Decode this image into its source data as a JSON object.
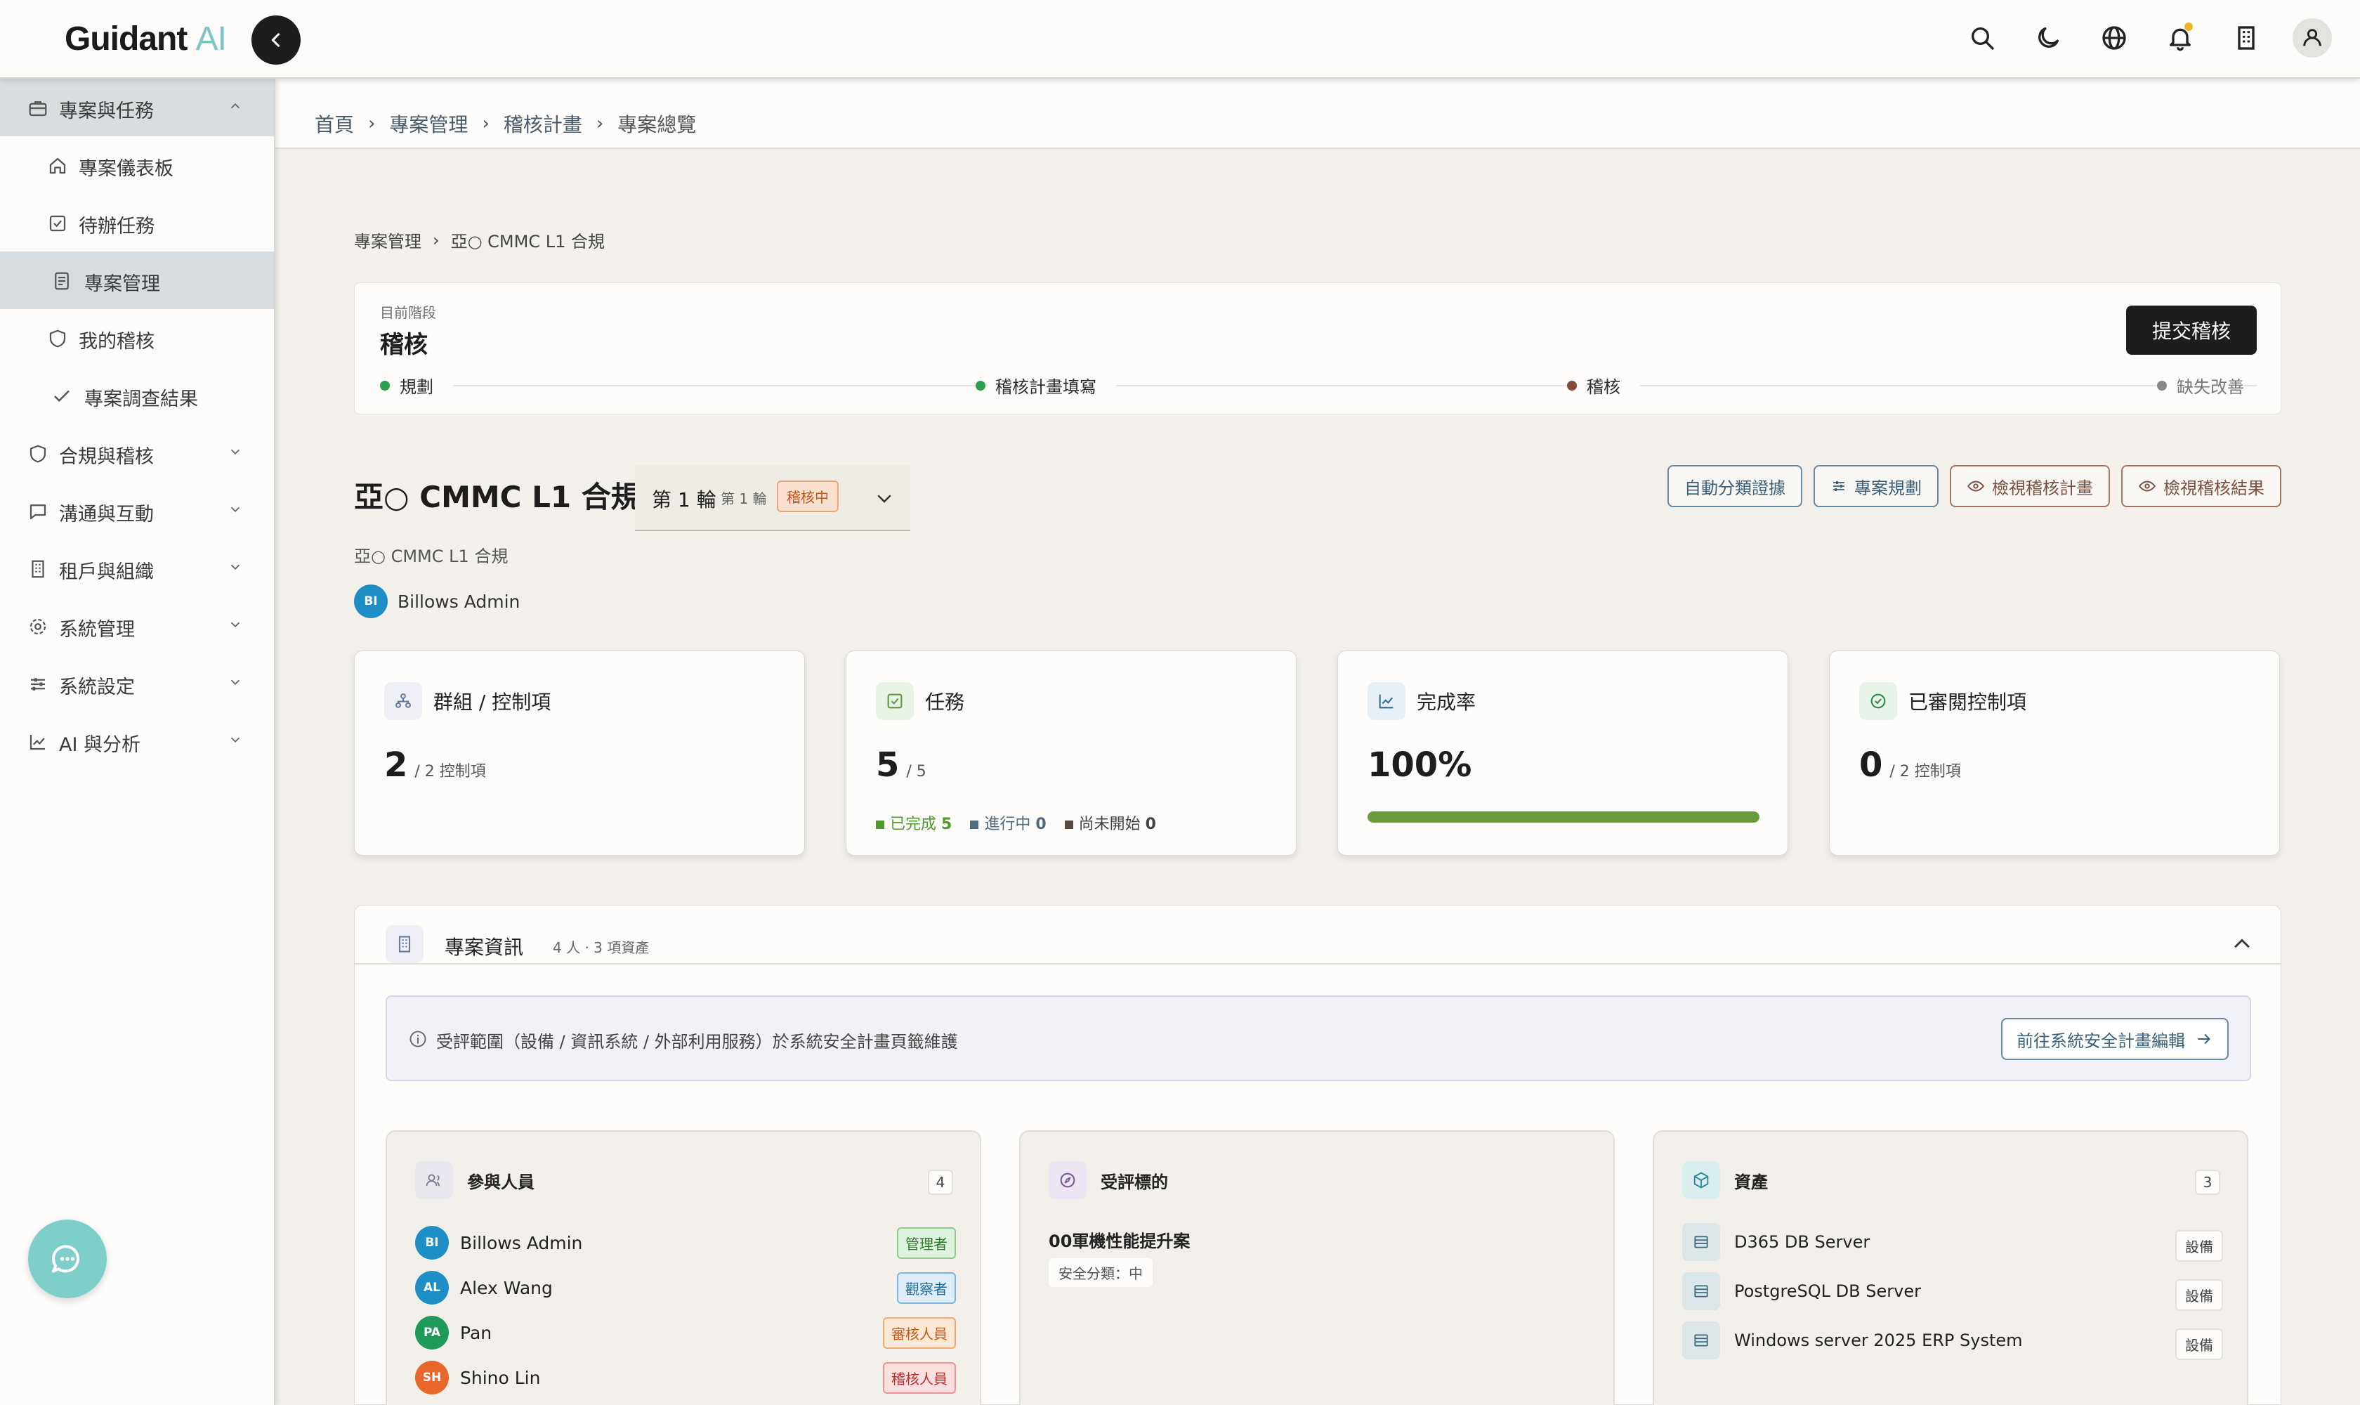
{
  "app": {
    "logo_main": "Guidant",
    "logo_accent": "AI"
  },
  "header_icons": [
    "search-icon",
    "moon-icon",
    "globe-icon",
    "bell-icon",
    "building-icon",
    "user-icon"
  ],
  "sidebar": {
    "items": [
      {
        "label": "專案與任務",
        "icon": "briefcase-icon",
        "expanded": true
      },
      {
        "label": "專案儀表板",
        "icon": "home-icon"
      },
      {
        "label": "待辦任務",
        "icon": "checkbox-icon"
      },
      {
        "label": "專案管理",
        "icon": "document-icon",
        "active": true
      },
      {
        "label": "我的稽核",
        "icon": "shield-icon"
      },
      {
        "label": "專案調查結果",
        "icon": "check-icon"
      },
      {
        "label": "合規與稽核",
        "icon": "shield-icon"
      },
      {
        "label": "溝通與互動",
        "icon": "chat-icon"
      },
      {
        "label": "租戶與組織",
        "icon": "building-icon"
      },
      {
        "label": "系統管理",
        "icon": "gear-icon"
      },
      {
        "label": "系統設定",
        "icon": "sliders-icon"
      },
      {
        "label": "AI 與分析",
        "icon": "chart-icon"
      }
    ]
  },
  "breadcrumb": [
    "首頁",
    "專案管理",
    "稽核計畫",
    "專案總覽"
  ],
  "sub_breadcrumb": [
    "專案管理",
    "亞○ CMMC L1 合規"
  ],
  "stage": {
    "label": "目前階段",
    "value": "稽核",
    "submit": "提交稽核",
    "steps": [
      {
        "label": "規劃",
        "color": "#2e9e4f"
      },
      {
        "label": "稽核計畫填寫",
        "color": "#2e9e4f"
      },
      {
        "label": "稽核",
        "color": "#8a4a3a"
      },
      {
        "label": "缺失改善",
        "color": "#888888"
      }
    ]
  },
  "project": {
    "title": "亞○ CMMC L1 合規",
    "subtitle": "亞○ CMMC L1 合規",
    "owner_initials": "BI",
    "owner_name": "Billows Admin",
    "round_label": "第 1 輪",
    "round_small": "第 1 輪",
    "round_status": "稽核中",
    "actions": [
      "自動分類證據",
      "專案規劃",
      "檢視稽核計畫",
      "檢視稽核結果"
    ]
  },
  "stats": {
    "groups": {
      "title": "群組 / 控制項",
      "value": "2",
      "suffix": "/ 2 控制項"
    },
    "tasks": {
      "title": "任務",
      "value": "5",
      "suffix": "/ 5",
      "done_label": "已完成",
      "done": "5",
      "progress_label": "進行中",
      "progress": "0",
      "notstarted_label": "尚未開始",
      "notstarted": "0"
    },
    "completion": {
      "title": "完成率",
      "value": "100%",
      "percent": 100
    },
    "reviewed": {
      "title": "已審閱控制項",
      "value": "0",
      "suffix": "/ 2 控制項"
    }
  },
  "info": {
    "title": "專案資訊",
    "meta": "4 人 · 3 項資產",
    "notice": "受評範圍（設備 / 資訊系統 / 外部利用服務）於系統安全計畫頁籤維護",
    "notice_button": "前往系統安全計畫編輯",
    "participants": {
      "title": "參與人員",
      "count": "4",
      "people": [
        {
          "initials": "BI",
          "name": "Billows Admin",
          "role": "管理者",
          "avatar": "#1e8fc6"
        },
        {
          "initials": "AL",
          "name": "Alex Wang",
          "role": "觀察者",
          "avatar": "#1e8fc6"
        },
        {
          "initials": "PA",
          "name": "Pan",
          "role": "審核人員",
          "avatar": "#1f9a5a"
        },
        {
          "initials": "SH",
          "name": "Shino Lin",
          "role": "稽核人員",
          "avatar": "#e8672a"
        }
      ]
    },
    "target": {
      "title": "受評標的",
      "name": "00軍機性能提升案",
      "tag": "安全分類：中"
    },
    "assets": {
      "title": "資產",
      "count": "3",
      "items": [
        {
          "name": "D365 DB Server",
          "tag": "設備"
        },
        {
          "name": "PostgreSQL DB Server",
          "tag": "設備"
        },
        {
          "name": "Windows server 2025 ERP System",
          "tag": "設備"
        }
      ]
    }
  }
}
